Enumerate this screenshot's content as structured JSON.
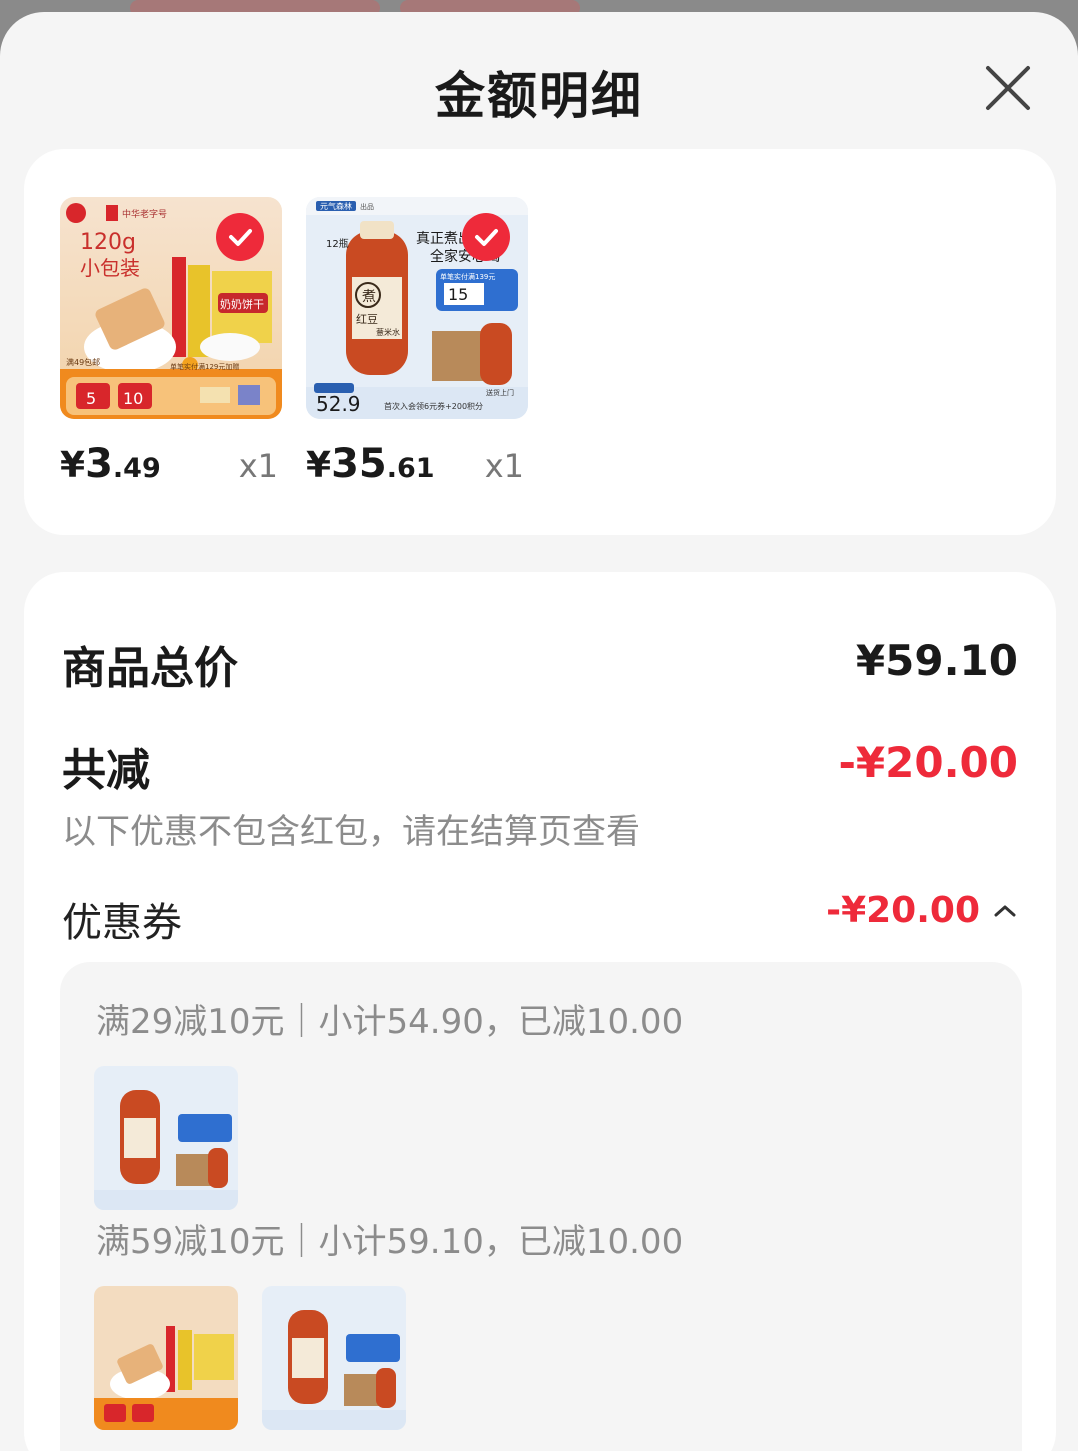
{
  "header": {
    "title": "金额明细",
    "close_icon": "close-icon"
  },
  "cart_items": [
    {
      "price_symbol": "¥",
      "price_int": "3",
      "price_dec": ".49",
      "quantity": "x1",
      "image_texts": [
        "120g",
        "小包装",
        "中华老字号",
        "奶奶饼干",
        "满49包邮",
        "单笔实付满129元加赠",
        "5",
        "10"
      ]
    },
    {
      "price_symbol": "¥",
      "price_int": "35",
      "price_dec": ".61",
      "quantity": "x1",
      "image_texts": [
        "元气森林",
        "出品",
        "真正煮出来的",
        "全家安心喝",
        "煮",
        "红豆",
        "薏米水",
        "12瓶",
        "15",
        "52.9",
        "首次入会领6元券+200积分",
        "单笔实付满139元",
        "送货上门"
      ]
    }
  ],
  "summary": {
    "total_label": "商品总价",
    "total_value": "¥59.10",
    "discount_label": "共减",
    "discount_value": "-¥20.00",
    "discount_note": "以下优惠不包含红包，请在结算页查看",
    "coupon_label": "优惠券",
    "coupon_value": "-¥20.00"
  },
  "coupon_rules": [
    {
      "text": "满29减10元｜小计54.90，已减10.00"
    },
    {
      "text": "满59减10元｜小计59.10，已减10.00"
    }
  ],
  "colors": {
    "accent_red": "#ee2a3a",
    "sheet_bg": "#f5f5f5",
    "card_bg": "#ffffff",
    "muted_text": "#8c8c8c"
  }
}
